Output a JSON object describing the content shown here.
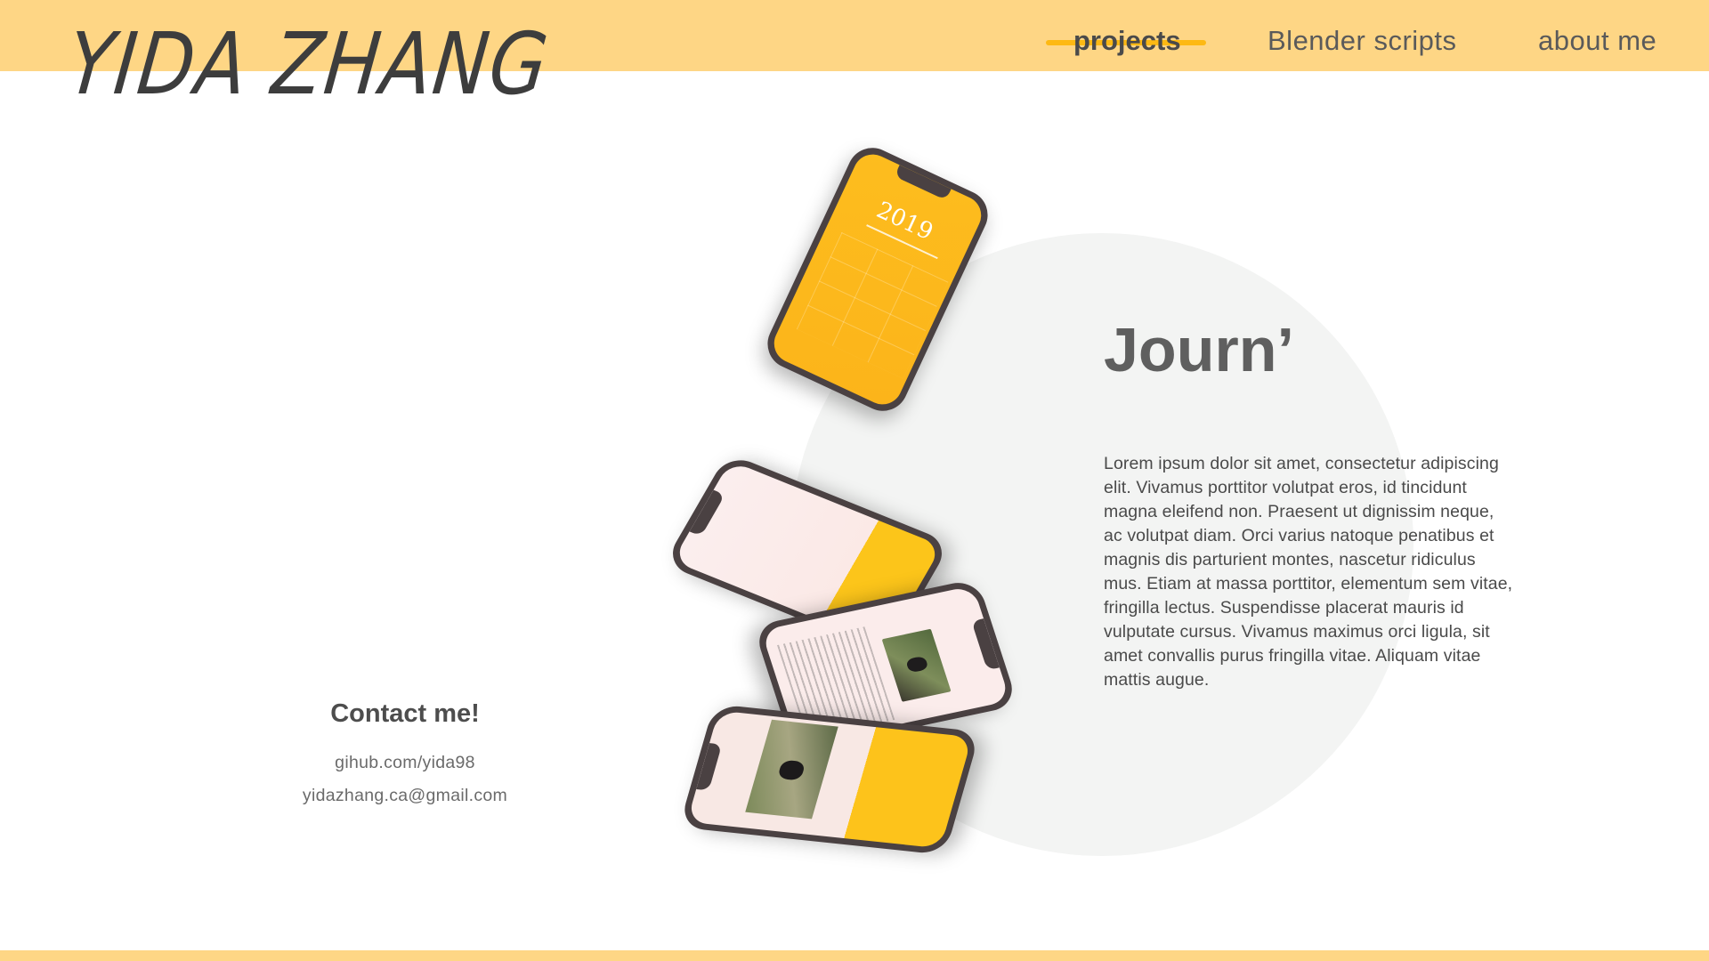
{
  "header": {
    "logo_text": "YIDA ZHANG",
    "nav": {
      "projects": "projects",
      "blender": "Blender scripts",
      "about": "about me"
    },
    "active_tab": "projects"
  },
  "colors": {
    "band": "#fed685",
    "accent": "#fdb913",
    "circle": "#f3f4f3",
    "text": "#4a4a4a"
  },
  "project": {
    "title": "Journ’",
    "description": "Lorem ipsum dolor sit amet, consectetur adipiscing elit. Vivamus porttitor volutpat eros, id tincidunt magna eleifend non. Praesent ut dignissim neque, ac volutpat diam. Orci varius natoque penatibus et magnis dis parturient montes, nascetur ridiculus mus. Etiam at massa porttitor, elementum sem vitae, fringilla lectus. Suspendisse placerat mauris id vulputate cursus. Vivamus maximus orci ligula, sit amet convallis purus fringilla vitae. Aliquam vitae mattis augue.",
    "phone_screens": {
      "year": "2019"
    }
  },
  "contact": {
    "title": "Contact me!",
    "github": "gihub.com/yida98",
    "email": "yidazhang.ca@gmail.com"
  }
}
